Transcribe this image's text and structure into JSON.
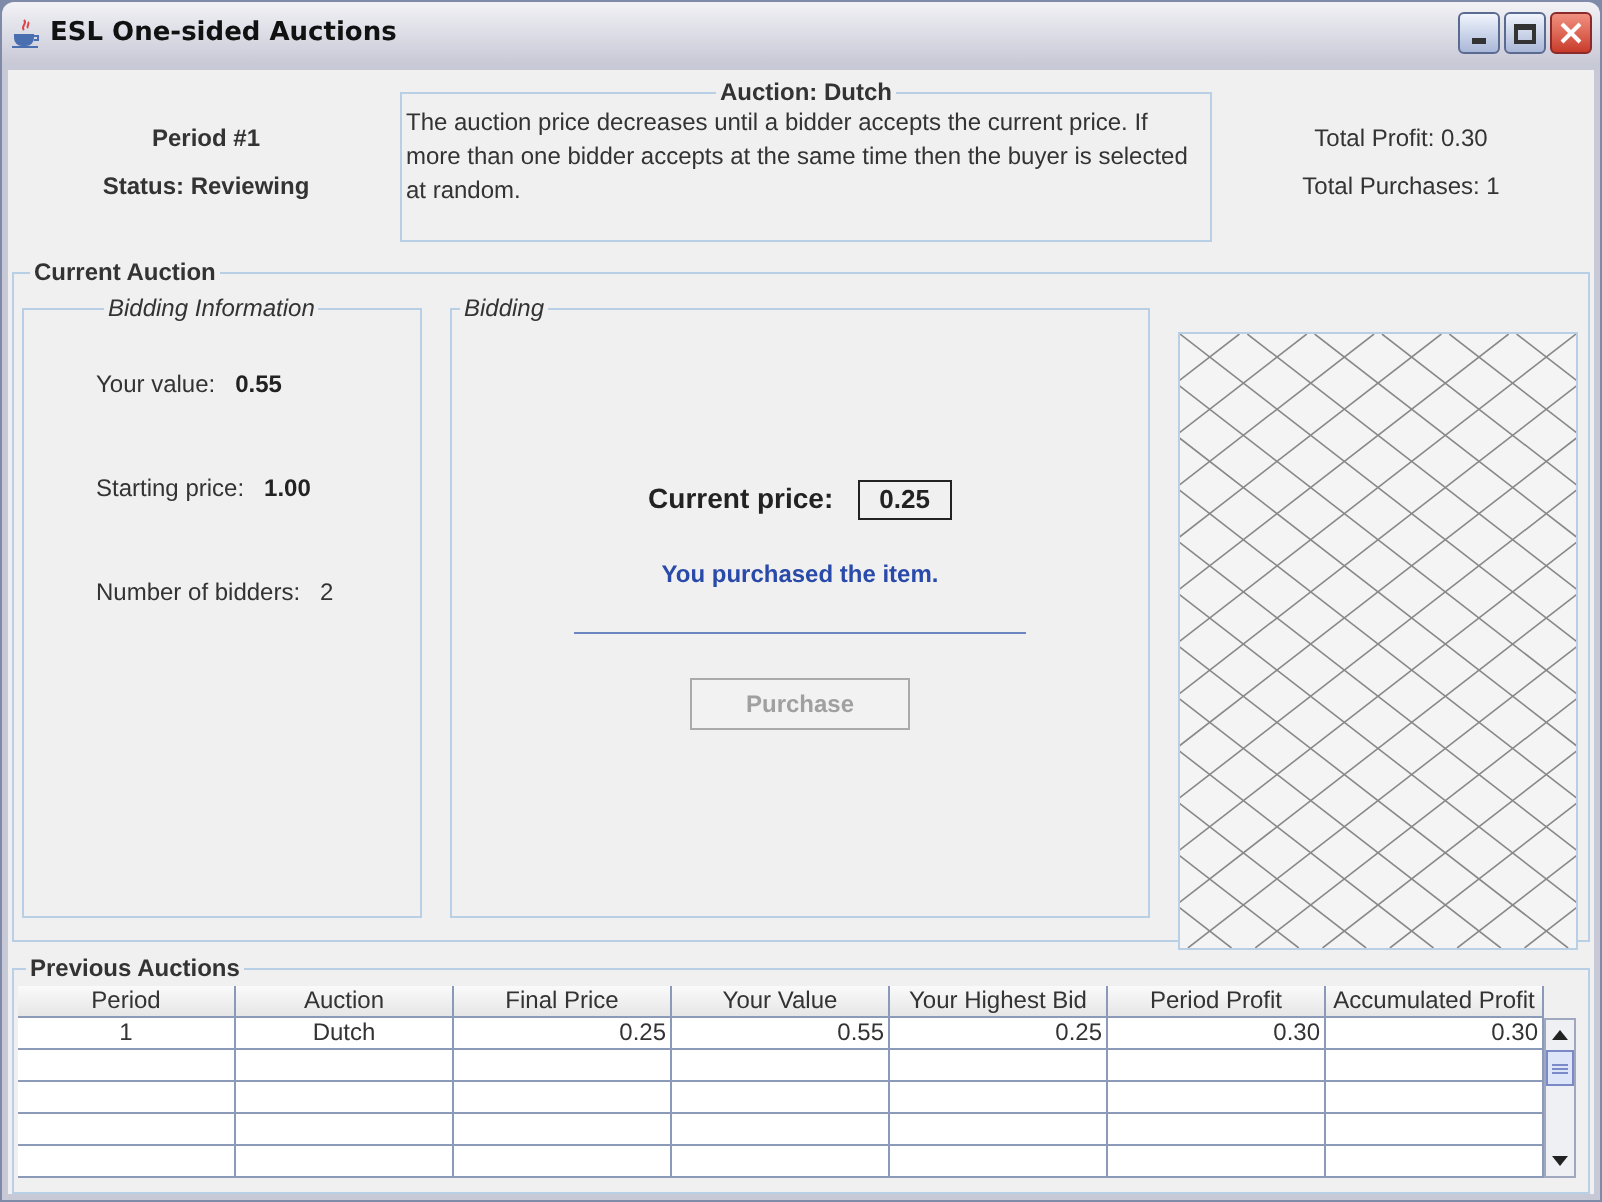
{
  "window": {
    "title": "ESL One-sided Auctions"
  },
  "header": {
    "period": "Period #1",
    "status": "Status: Reviewing",
    "auction_box": {
      "title": "Auction: Dutch",
      "description": "The auction price decreases until a bidder accepts the current price. If more than one bidder accepts at the same time then the buyer is selected at random."
    },
    "total_profit": "Total Profit: 0.30",
    "total_purchases": "Total Purchases: 1"
  },
  "current_auction": {
    "title": "Current Auction",
    "bidding_information": {
      "title": "Bidding Information",
      "rows": [
        {
          "label": "Your value:",
          "value": "0.55",
          "emphasized": true
        },
        {
          "label": "Starting price:",
          "value": "1.00",
          "emphasized": true
        },
        {
          "label": "Number of bidders:",
          "value": "2",
          "emphasized": false
        }
      ]
    },
    "bidding": {
      "title": "Bidding",
      "price_label": "Current price:",
      "price": "0.25",
      "message": "You purchased the item.",
      "button": {
        "label": "Purchase",
        "disabled": true
      }
    }
  },
  "previous_auctions": {
    "title": "Previous Auctions",
    "table": {
      "columns": [
        "Period",
        "Auction",
        "Final Price",
        "Your Value",
        "Your Highest Bid",
        "Period Profit",
        "Accumulated Profit"
      ],
      "rows": [
        [
          "1",
          "Dutch",
          "0.25",
          "0.55",
          "0.25",
          "0.30",
          "0.30"
        ]
      ]
    }
  }
}
